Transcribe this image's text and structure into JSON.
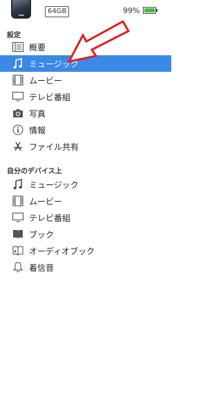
{
  "device": {
    "capacity": "64GB",
    "battery_percent": "99%",
    "battery_level": 0.99
  },
  "settings": {
    "title": "設定",
    "items": [
      {
        "label": "概要",
        "icon": "summary-list-icon"
      },
      {
        "label": "ミュージック",
        "icon": "music-note-icon",
        "selected": true
      },
      {
        "label": "ムービー",
        "icon": "film-icon"
      },
      {
        "label": "テレビ番組",
        "icon": "tv-icon"
      },
      {
        "label": "写真",
        "icon": "camera-icon"
      },
      {
        "label": "情報",
        "icon": "info-icon"
      },
      {
        "label": "ファイル共有",
        "icon": "app-store-icon"
      }
    ]
  },
  "on_device": {
    "title": "自分のデバイス上",
    "items": [
      {
        "label": "ミュージック",
        "icon": "music-note-icon"
      },
      {
        "label": "ムービー",
        "icon": "film-icon"
      },
      {
        "label": "テレビ番組",
        "icon": "tv-icon"
      },
      {
        "label": "ブック",
        "icon": "book-icon"
      },
      {
        "label": "オーディオブック",
        "icon": "audiobook-icon"
      },
      {
        "label": "着信音",
        "icon": "bell-icon"
      }
    ]
  },
  "colors": {
    "selection": "#3b89e6",
    "annotation_arrow": "#e02020",
    "battery": "#3dbb3d"
  }
}
